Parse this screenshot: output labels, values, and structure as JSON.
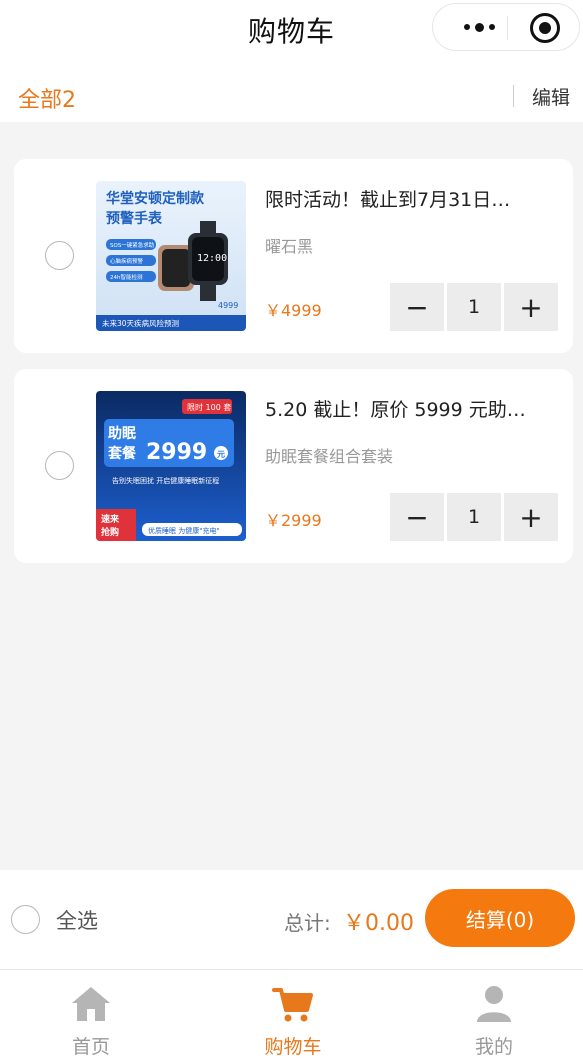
{
  "navbar": {
    "title": "购物车"
  },
  "toolbar": {
    "all_count": "全部2",
    "edit_label": "编辑"
  },
  "items": [
    {
      "title": "限时活动！截止到7月31日…",
      "spec": "曜石黑",
      "price": "￥4999",
      "quantity": "1",
      "thumb": {
        "headline": "华堂安顿定制款",
        "headline2": "预警手表",
        "features": [
          "SOS一键紧急求助",
          "心脑疾病预警",
          "24h智能检测"
        ],
        "price_tag": "4999",
        "footer": "未来30天疾病风险预测"
      }
    },
    {
      "title": "5.20 截止！原价 5999 元助…",
      "spec": "助眠套餐组合套装",
      "price": "￥2999",
      "quantity": "1",
      "thumb": {
        "badge": "限时 100 套",
        "headline": "助眠",
        "headline2": "套餐",
        "price_tag": "2999",
        "price_unit": "元",
        "slogan": "告别失眠困扰 开启健康睡眠新征程",
        "corner": "速来",
        "corner2": "抢购",
        "footer": "优质睡眠 为健康\"充电\""
      }
    }
  ],
  "footer": {
    "select_all": "全选",
    "total_label": "总计:",
    "total_value": "￥0.00",
    "checkout_label": "结算(0)"
  },
  "tabbar": {
    "tabs": [
      {
        "label": "首页"
      },
      {
        "label": "购物车"
      },
      {
        "label": "我的"
      }
    ]
  },
  "colors": {
    "accent": "#f47a0f",
    "price": "#e8781c"
  }
}
